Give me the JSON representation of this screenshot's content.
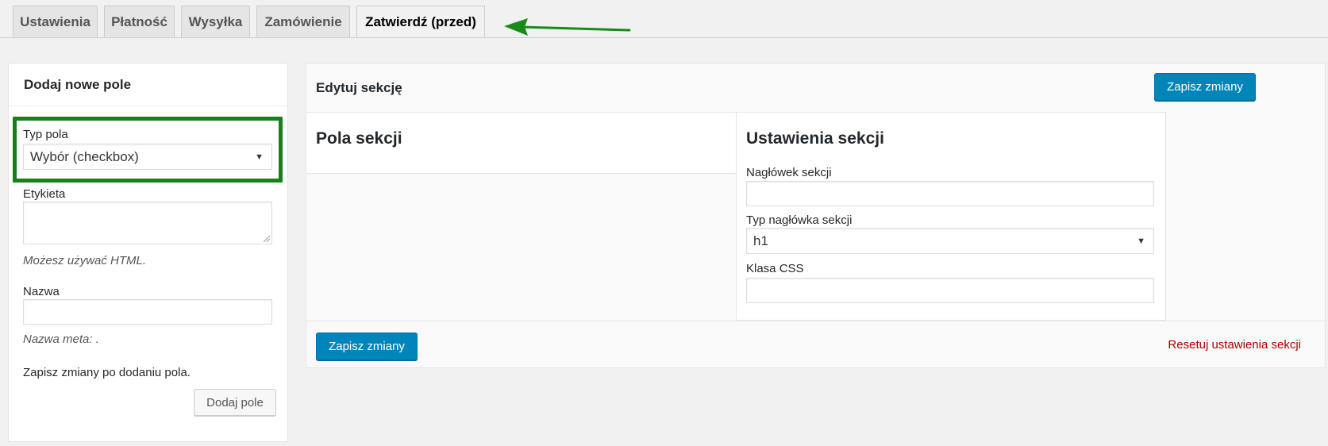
{
  "tabs": [
    {
      "label": "Ustawienia",
      "active": false
    },
    {
      "label": "Płatność",
      "active": false
    },
    {
      "label": "Wysyłka",
      "active": false
    },
    {
      "label": "Zamówienie",
      "active": false
    },
    {
      "label": "Zatwierdź (przed)",
      "active": true
    }
  ],
  "colors": {
    "accent": "#0085ba",
    "highlight": "#1a7f1a",
    "arrow": "#1a8a1a",
    "reset_link": "#aa0000"
  },
  "add_field_panel": {
    "title": "Dodaj nowe pole",
    "field_type_label": "Typ pola",
    "field_type_value": "Wybór (checkbox)",
    "label_label": "Etykieta",
    "label_value": "",
    "html_hint": "Możesz używać HTML.",
    "name_label": "Nazwa",
    "name_value": "",
    "meta_hint": "Nazwa meta: .",
    "save_note": "Zapisz zmiany po dodaniu pola.",
    "add_button": "Dodaj pole"
  },
  "edit_section": {
    "title": "Edytuj sekcję",
    "save_button_top": "Zapisz zmiany",
    "section_fields_title": "Pola sekcji",
    "section_settings_title": "Ustawienia sekcji",
    "heading_label": "Nagłówek sekcji",
    "heading_value": "",
    "heading_type_label": "Typ nagłówka sekcji",
    "heading_type_value": "h1",
    "css_class_label": "Klasa CSS",
    "css_class_value": "",
    "save_button_bottom": "Zapisz zmiany",
    "reset_link": "Resetuj ustawienia sekcji"
  }
}
